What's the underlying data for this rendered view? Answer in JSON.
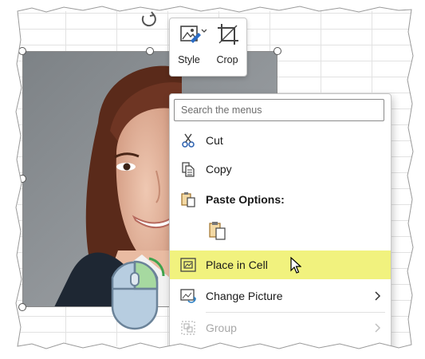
{
  "mini_toolbar": {
    "style_label": "Style",
    "crop_label": "Crop"
  },
  "context_menu": {
    "search_placeholder": "Search the menus",
    "items": [
      {
        "label": "Cut",
        "icon": "scissors-icon",
        "state": "normal"
      },
      {
        "label": "Copy",
        "icon": "copy-icon",
        "state": "normal"
      },
      {
        "label": "Paste Options:",
        "icon": "paste-icon",
        "state": "header"
      },
      {
        "label": "",
        "icon": "paste-picture-icon",
        "state": "option"
      },
      {
        "label": "Place in Cell",
        "icon": "place-in-cell-icon",
        "state": "highlighted"
      },
      {
        "label": "Change Picture",
        "icon": "change-picture-icon",
        "state": "submenu"
      },
      {
        "label": "Group",
        "icon": "group-icon",
        "state": "disabled-submenu"
      }
    ]
  },
  "colors": {
    "highlight": "#f1f27e",
    "mouse_button_right": "#a6d9a0",
    "mouse_body": "#b7cde0"
  }
}
